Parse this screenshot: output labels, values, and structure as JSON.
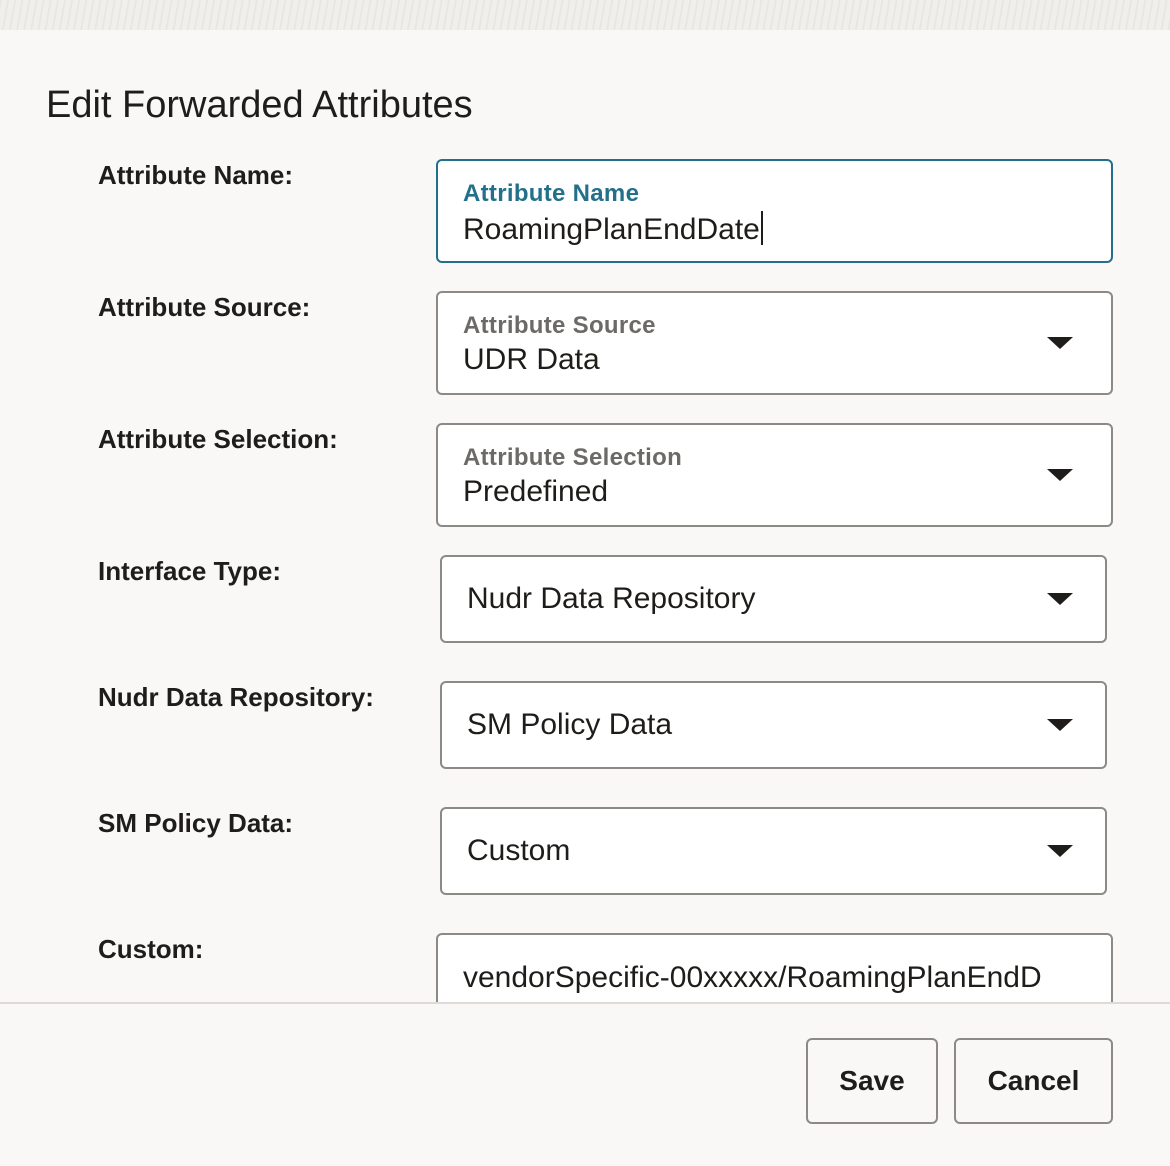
{
  "dialog": {
    "title": "Edit Forwarded Attributes"
  },
  "form": {
    "attribute_name": {
      "label": "Attribute Name:",
      "field_label": "Attribute Name",
      "value": "RoamingPlanEndDate"
    },
    "attribute_source": {
      "label": "Attribute Source:",
      "field_label": "Attribute Source",
      "value": "UDR Data"
    },
    "attribute_selection": {
      "label": "Attribute Selection:",
      "field_label": "Attribute Selection",
      "value": "Predefined"
    },
    "interface_type": {
      "label": "Interface Type:",
      "value": "Nudr Data Repository"
    },
    "nudr_data_repository": {
      "label": "Nudr Data Repository:",
      "value": "SM Policy Data"
    },
    "sm_policy_data": {
      "label": "SM Policy Data:",
      "value": "Custom"
    },
    "custom": {
      "label": "Custom:",
      "value": "vendorSpecific-00xxxxx/RoamingPlanEndD"
    }
  },
  "footer": {
    "save_label": "Save",
    "cancel_label": "Cancel"
  },
  "colors": {
    "focus_accent": "#23708a",
    "border": "#8d8a85",
    "background": "#f9f8f6"
  },
  "icons": {
    "dropdown": "chevron-down-icon"
  }
}
